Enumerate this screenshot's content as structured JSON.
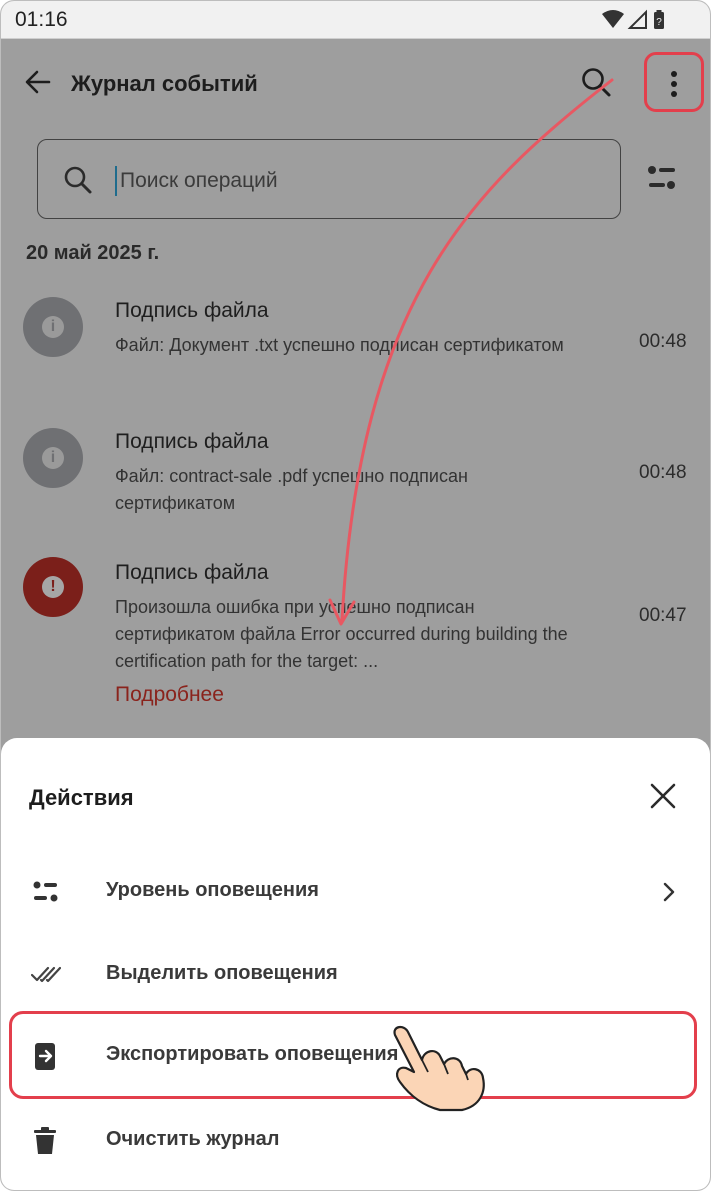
{
  "status_bar": {
    "time": "01:16"
  },
  "app_bar": {
    "title": "Журнал событий"
  },
  "search": {
    "placeholder": "Поиск операций"
  },
  "date_header": "20 май 2025 г.",
  "events": [
    {
      "title": "Подпись файла",
      "body": "Файл: Документ .txt успешно подписан сертификатом",
      "time": "00:48",
      "level": "info",
      "icon": "info-icon"
    },
    {
      "title": "Подпись файла",
      "body": "Файл: contract-sale .pdf успешно подписан сертификатом",
      "time": "00:48",
      "level": "info",
      "icon": "info-icon"
    },
    {
      "title": "Подпись файла",
      "body": "Произошла ошибка при успешно подписан сертификатом файла Error occurred during building the certification path for the target: ...",
      "time": "00:47",
      "level": "error",
      "icon": "error-icon",
      "more_label": "Подробнее"
    }
  ],
  "sheet": {
    "title": "Действия",
    "items": [
      {
        "label": "Уровень оповещения",
        "icon": "level-filter-icon",
        "has_chevron": true
      },
      {
        "label": "Выделить оповещения",
        "icon": "double-check-icon",
        "has_chevron": false
      },
      {
        "label": "Экспортировать оповещения",
        "icon": "export-icon",
        "has_chevron": false,
        "highlighted": true
      },
      {
        "label": "Очистить журнал",
        "icon": "trash-icon",
        "has_chevron": false
      }
    ]
  },
  "colors": {
    "highlight": "#e33f4c",
    "error": "#7b1f1a",
    "link": "#8a231c",
    "info_badge": "#6f7073"
  }
}
